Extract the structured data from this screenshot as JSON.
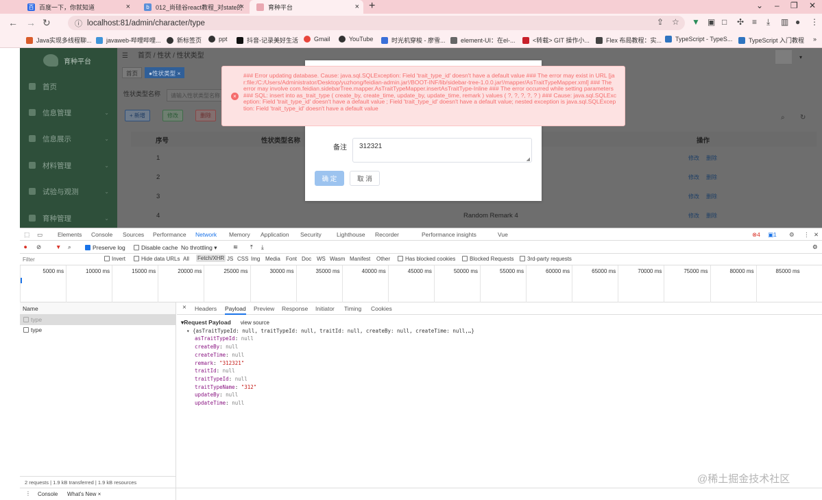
{
  "browser": {
    "tabs": [
      {
        "title": "百度一下，你就知道",
        "active": false
      },
      {
        "title": "012_尚硅谷react教程_对state的",
        "active": false
      },
      {
        "title": "育种平台",
        "active": true
      }
    ],
    "new_tab": "+",
    "url": "localhost:81/admin/character/type",
    "bookmarks": [
      "Java实现多线程聊...",
      "javaweb-哔哩哔哩...",
      "新标签页",
      "ppt",
      "抖音-记录美好生活",
      "Gmail",
      "YouTube",
      "时光机穿梭 - 廖雪...",
      "element-UI：在el-...",
      "<转载> GIT 操作小...",
      "Flex 布局教程：实...",
      "TypeScript - TypeS...",
      "TypeScript 入门教程"
    ]
  },
  "app": {
    "logo": "育种平台",
    "menu": [
      "首页",
      "信息管理",
      "信息展示",
      "材料管理",
      "试验与观测",
      "育种管理"
    ],
    "breadcrumb": "首页 / 性状 / 性状类型",
    "tags": [
      "首页",
      "●性状类型 ×"
    ],
    "filter_label": "性状类型名称",
    "filter_placeholder": "请输入性状类型名称",
    "buttons": {
      "add": "+ 新增",
      "edit": "修改",
      "delete": "删除"
    },
    "table": {
      "headers": [
        "序号",
        "性状类型名称",
        "操作"
      ],
      "rows": [
        {
          "index": "1",
          "remark": ""
        },
        {
          "index": "2",
          "remark": ""
        },
        {
          "index": "3",
          "remark": ""
        },
        {
          "index": "4",
          "remark": "Random Remark 4"
        }
      ],
      "op_edit": "修改",
      "op_delete": "删除"
    }
  },
  "dialog": {
    "remark_label": "备注",
    "remark_value": "312321",
    "confirm": "确 定",
    "cancel": "取 消"
  },
  "error": {
    "icon": "×",
    "message": "### Error updating database. Cause: java.sql.SQLException: Field 'trait_type_id' doesn't have a default value ### The error may exist in URL [jar:file:/C:/Users/Administrator/Desktop/yuzhong/feidian-admin.jar!/BOOT-INF/lib/sidebar-tree-1.0.0.jar!/mapper/AsTraitTypeMapper.xml] ### The error may involve com.feidian.sidebarTree.mapper.AsTraitTypeMapper.insertAsTraitType-Inline ### The error occurred while setting parameters ### SQL: insert into as_trait_type ( create_by, create_time, update_by, update_time, remark ) values ( ?, ?, ?, ?, ? ) ### Cause: java.sql.SQLException: Field 'trait_type_id' doesn't have a default value ; Field 'trait_type_id' doesn't have a default value; nested exception is java.sql.SQLException: Field 'trait_type_id' doesn't have a default value"
  },
  "devtools": {
    "tabs": [
      "Elements",
      "Console",
      "Sources",
      "Performance",
      "Network",
      "Memory",
      "Application",
      "Security",
      "Lighthouse",
      "Recorder",
      "Performance insights",
      "Vue"
    ],
    "badges": {
      "errors": "4",
      "messages": "1"
    },
    "toolbar": {
      "preserve_log": "Preserve log",
      "disable_cache": "Disable cache",
      "throttling": "No throttling"
    },
    "filter_placeholder": "Filter",
    "filter_options": [
      "Invert",
      "Hide data URLs",
      "All",
      "Fetch/XHR",
      "JS",
      "CSS",
      "Img",
      "Media",
      "Font",
      "Doc",
      "WS",
      "Wasm",
      "Manifest",
      "Other",
      "Has blocked cookies",
      "Blocked Requests",
      "3rd-party requests"
    ],
    "timeline_ticks": [
      "5000 ms",
      "10000 ms",
      "15000 ms",
      "20000 ms",
      "25000 ms",
      "30000 ms",
      "35000 ms",
      "40000 ms",
      "45000 ms",
      "50000 ms",
      "55000 ms",
      "60000 ms",
      "65000 ms",
      "70000 ms",
      "75000 ms",
      "80000 ms",
      "85000 ms"
    ],
    "name_header": "Name",
    "requests": [
      "type",
      "type"
    ],
    "summary": "2 requests  |  1.9 kB transferred  |  1.9 kB resources",
    "detail_tabs": [
      "×",
      "Headers",
      "Payload",
      "Preview",
      "Response",
      "Initiator",
      "Timing",
      "Cookies"
    ],
    "payload_title": "▾Request Payload",
    "view_source": "view source",
    "payload_summary": "▾ {asTraitTypeId: null, traitTypeId: null, traitId: null, createBy: null, createTime: null,…}",
    "payload_fields": [
      {
        "key": "asTraitTypeId",
        "value": "null"
      },
      {
        "key": "createBy",
        "value": "null"
      },
      {
        "key": "createTime",
        "value": "null"
      },
      {
        "key": "remark",
        "value": "\"312321\""
      },
      {
        "key": "traitId",
        "value": "null"
      },
      {
        "key": "traitTypeId",
        "value": "null"
      },
      {
        "key": "traitTypeName",
        "value": "\"312\""
      },
      {
        "key": "updateBy",
        "value": "null"
      },
      {
        "key": "updateTime",
        "value": "null"
      }
    ],
    "drawer_tabs": [
      "Console",
      "What's New ×"
    ]
  },
  "watermark": "@稀土掘金技术社区"
}
